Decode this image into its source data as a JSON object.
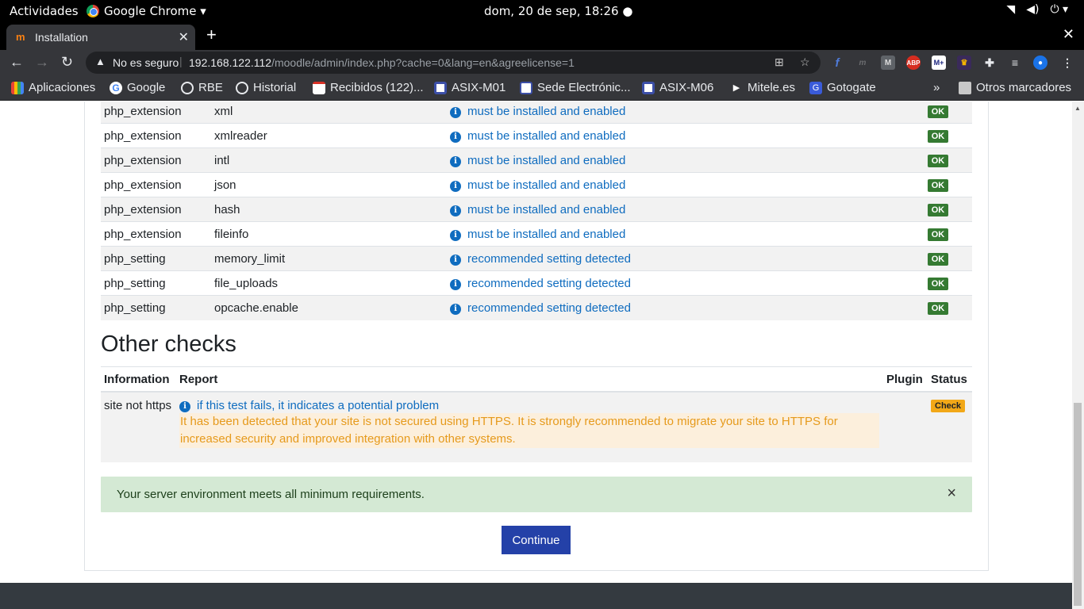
{
  "system_bar": {
    "activities": "Actividades",
    "app_name": "Google Chrome ▾",
    "clock": "dom, 20 de sep, 18:26 ●"
  },
  "browser": {
    "tab_title": "Installation",
    "security_label": "No es seguro",
    "url_host": "192.168.122.112",
    "url_path": "/moodle/admin/index.php?cache=0&lang=en&agreelicense=1",
    "extensions": [
      "f",
      "m",
      "M",
      "ABP",
      "M+",
      "crown",
      "puzzle",
      "queue",
      "avatar"
    ]
  },
  "bookmarks": {
    "items": [
      "Aplicaciones",
      "Google",
      "RBE",
      "Historial",
      "Recibidos (122)...",
      "ASIX-M01",
      "Sede Electrónic...",
      "ASIX-M06",
      "Mitele.es",
      "Gotogate"
    ],
    "overflow": "»",
    "other": "Otros marcadores"
  },
  "environment": {
    "rows": [
      {
        "type": "php_extension",
        "name": "xml",
        "report": "must be installed and enabled",
        "status": "OK"
      },
      {
        "type": "php_extension",
        "name": "xmlreader",
        "report": "must be installed and enabled",
        "status": "OK"
      },
      {
        "type": "php_extension",
        "name": "intl",
        "report": "must be installed and enabled",
        "status": "OK"
      },
      {
        "type": "php_extension",
        "name": "json",
        "report": "must be installed and enabled",
        "status": "OK"
      },
      {
        "type": "php_extension",
        "name": "hash",
        "report": "must be installed and enabled",
        "status": "OK"
      },
      {
        "type": "php_extension",
        "name": "fileinfo",
        "report": "must be installed and enabled",
        "status": "OK"
      },
      {
        "type": "php_setting",
        "name": "memory_limit",
        "report": "recommended setting detected",
        "status": "OK"
      },
      {
        "type": "php_setting",
        "name": "file_uploads",
        "report": "recommended setting detected",
        "status": "OK"
      },
      {
        "type": "php_setting",
        "name": "opcache.enable",
        "report": "recommended setting detected",
        "status": "OK"
      }
    ]
  },
  "other_checks": {
    "heading": "Other checks",
    "headers": {
      "information": "Information",
      "report": "Report",
      "plugin": "Plugin",
      "status": "Status"
    },
    "row": {
      "information": "site not https",
      "report": "if this test fails, it indicates a potential problem",
      "warning": "It has been detected that your site is not secured using HTTPS. It is strongly recommended to migrate your site to HTTPS for increased security and improved integration with other systems.",
      "status": "Check"
    }
  },
  "alert": {
    "message": "Your server environment meets all minimum requirements.",
    "close": "×"
  },
  "continue_label": "Continue",
  "colors": {
    "ok_badge": "#357a32",
    "check_badge": "#f2a818",
    "link": "#0f6cbf",
    "success_bg": "#d4e9d4",
    "primary_button": "#2441a8"
  }
}
